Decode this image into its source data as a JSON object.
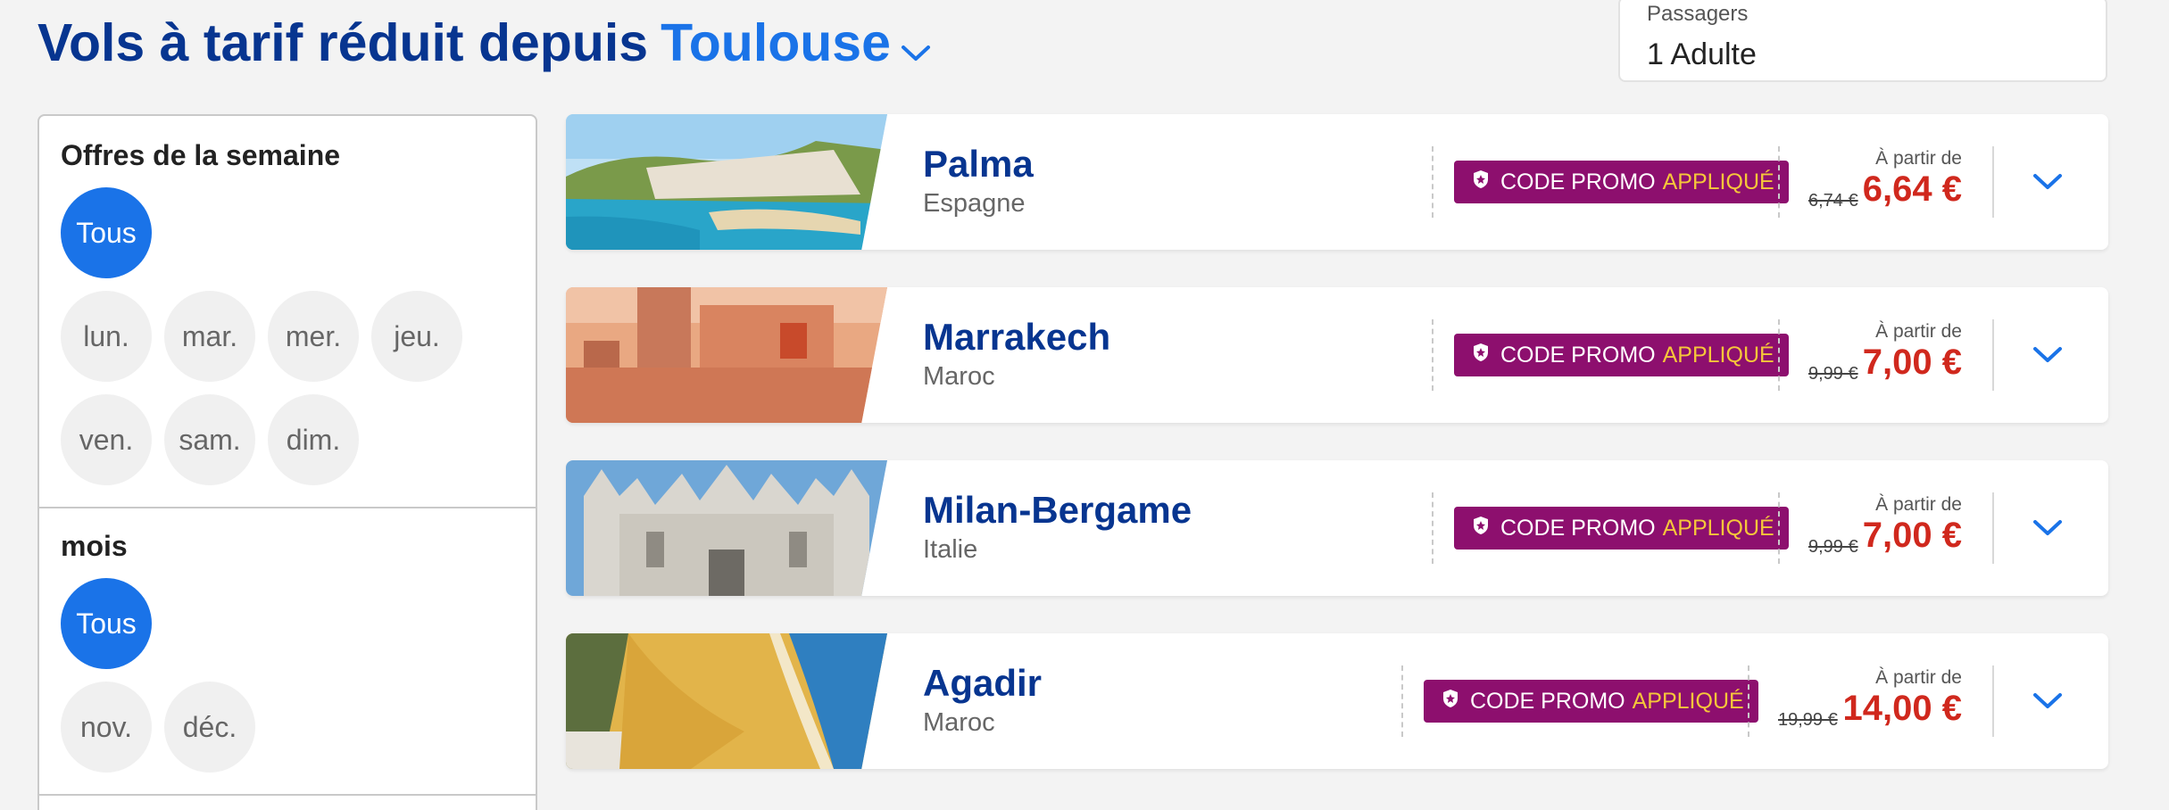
{
  "header": {
    "title_prefix": "Vols à tarif réduit depuis",
    "city": "Toulouse"
  },
  "passengers": {
    "label": "Passagers",
    "value": "1 Adulte"
  },
  "filters": {
    "week": {
      "title": "Offres de la semaine",
      "options": [
        "Tous",
        "lun.",
        "mar.",
        "mer.",
        "jeu.",
        "ven.",
        "sam.",
        "dim."
      ],
      "selected": "Tous"
    },
    "month": {
      "title": "mois",
      "options": [
        "Tous",
        "nov.",
        "déc."
      ],
      "selected": "Tous"
    }
  },
  "promo": {
    "label": "CODE PROMO",
    "applied": "APPLIQUÉ"
  },
  "from_label": "À partir de",
  "deals": [
    {
      "city": "Palma",
      "country": "Espagne",
      "old_price": "6,74 €",
      "price": "6,64 €"
    },
    {
      "city": "Marrakech",
      "country": "Maroc",
      "old_price": "9,99 €",
      "price": "7,00 €"
    },
    {
      "city": "Milan-Bergame",
      "country": "Italie",
      "old_price": "9,99 €",
      "price": "7,00 €"
    },
    {
      "city": "Agadir",
      "country": "Maroc",
      "old_price": "19,99 €",
      "price": "14,00 €"
    }
  ],
  "colors": {
    "primary_navy": "#073590",
    "accent_blue": "#1a73e8",
    "promo_purple": "#8d0f6e",
    "promo_yellow": "#f5c63a",
    "price_red": "#d0281d"
  }
}
